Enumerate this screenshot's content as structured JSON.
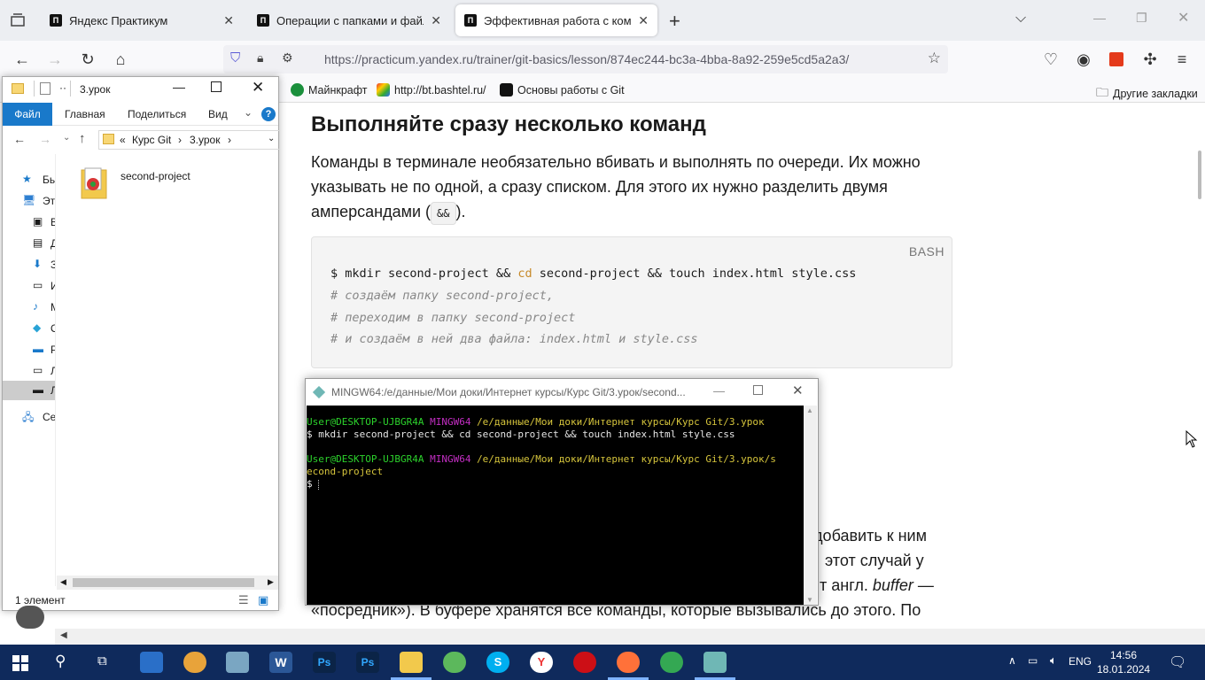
{
  "browser": {
    "tabs": [
      {
        "title": "Яндекс Практикум",
        "active": false
      },
      {
        "title": "Операции с папками и файлами",
        "active": false
      },
      {
        "title": "Эффективная работа с командами",
        "active": true
      }
    ],
    "url": "https://practicum.yandex.ru/trainer/git-basics/lesson/874ec244-bc3a-4bba-8a92-259e5cd5a2a3/",
    "bookmarks": [
      "Майнкрафт",
      "http://bt.bashtel.ru/",
      "Основы работы с Git"
    ],
    "other_bookmarks": "Другие закладки"
  },
  "page": {
    "heading": "Выполняйте сразу несколько команд",
    "paragraph_before": "Команды в терминале необязательно вбивать и выполнять по очереди. Их можно указывать не по одной, а сразу списком. Для этого их нужно разделить двумя амперсандами (",
    "inline_code": "&&",
    "paragraph_after": ").",
    "code_lang": "BASH",
    "code_cmd_prefix": "$ mkdir second-project && ",
    "code_cmd_kw": "cd",
    "code_cmd_suffix": " second-project && touch index.html style.css",
    "code_comments": [
      "# создаём папку second-project,",
      "# переходим в папку second-project",
      "# и создаём в ней два файла: index.html и style.css"
    ],
    "bottom_lines": [
      "и добавить к ним",
      "этот случай у",
      "т англ. ",
      "«посредник»). В буфере хранятся все команды, которые вызывались до этого. По"
    ],
    "bottom_italic": "buffer",
    "bottom_dash": " —"
  },
  "explorer": {
    "title": "3.урок",
    "ribbon": {
      "file": "Файл",
      "home": "Главная",
      "share": "Поделиться",
      "view": "Вид"
    },
    "path": [
      "«",
      "Курс Git",
      "›",
      "3.урок",
      "›"
    ],
    "nav_labels": [
      "Бь",
      "Эт",
      "В",
      "Д",
      "З",
      "И",
      "М",
      "О",
      "Р",
      "Л",
      "Л",
      "Се"
    ],
    "files": [
      {
        "name": "second-project"
      }
    ],
    "status": "1 элемент"
  },
  "gitbash": {
    "title": "MINGW64:/e/данные/Мои доки/Интернет курсы/Курс Git/3.урок/second...",
    "lines": [
      {
        "user": "User@DESKTOP-UJBGR4A",
        "env": "MINGW64",
        "path": "/e/данные/Мои доки/Интернет курсы/Курс Git/3.урок"
      },
      {
        "cmd": "$ mkdir second-project && cd second-project && touch index.html style.css"
      },
      {
        "blank": ""
      },
      {
        "user": "User@DESKTOP-UJBGR4A",
        "env": "MINGW64",
        "path": "/e/данные/Мои доки/Интернет курсы/Курс Git/3.урок/s"
      },
      {
        "path_cont": "econd-project"
      },
      {
        "prompt": "$ "
      }
    ]
  },
  "taskbar": {
    "lang": "ENG",
    "time": "14:56",
    "date": "18.01.2024"
  },
  "colors": {
    "taskbar": "#0f2a5c",
    "explorer_file_tab": "#1979ca",
    "term_green": "#2cd22c",
    "term_magenta": "#c32ec3",
    "term_yellow": "#d6c53c"
  }
}
